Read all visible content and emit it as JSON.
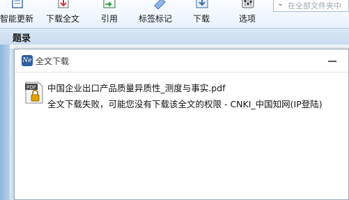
{
  "toolbar": {
    "buttons": [
      {
        "label": "智能更新",
        "icon": "smart-update-icon"
      },
      {
        "label": "下载全文",
        "icon": "download-fulltext-icon"
      },
      {
        "label": "引用",
        "icon": "cite-icon"
      },
      {
        "label": "标签标记",
        "icon": "tag-mark-icon"
      },
      {
        "label": "下载",
        "icon": "download-icon"
      },
      {
        "label": "选项",
        "icon": "options-icon"
      }
    ],
    "search_placeholder": "在全部文件夹中"
  },
  "section": {
    "title": "题录"
  },
  "dialog": {
    "title": "全文下载",
    "app_icon_text": "Ne",
    "item": {
      "filename": "中国企业出口产品质量异质性_测度与事实.pdf",
      "status": "全文下载失败，可能您没有下载该全文的权限  -  CNKI_中国知网(IP登陆)",
      "icon_badge": "PDF"
    }
  },
  "colors": {
    "accent": "#2e5f9e",
    "toolbar_bg": "#eaf2fb",
    "section_bg": "#cfe0f1"
  }
}
